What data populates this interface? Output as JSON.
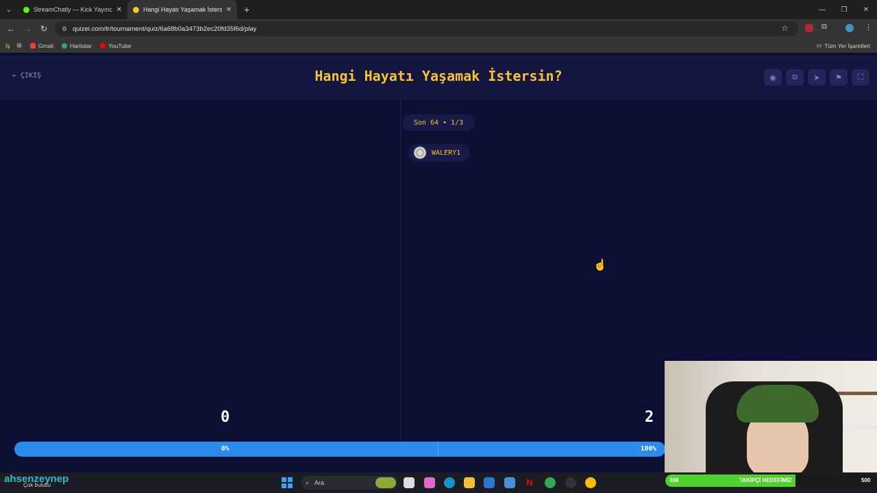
{
  "browser": {
    "tabs": [
      {
        "label": "StreamChatly — Kick Yayıncıları",
        "active": false,
        "fav_color": "#53fc18"
      },
      {
        "label": "Hangi Hayatı Yaşamak İstersin?",
        "active": true,
        "fav_color": "#f7c531"
      }
    ],
    "url": "quizei.com/tr/tournament/quiz/6a68b0a3473b2ec20fd35f6d/play",
    "bookmarks": [
      {
        "label": "Gmail",
        "color": "#ea4335"
      },
      {
        "label": "Haritalar",
        "color": "#34a853"
      },
      {
        "label": "YouTube",
        "color": "#ff0000"
      }
    ],
    "all_bookmarks": "Tüm Yer İşaretleri"
  },
  "page": {
    "exit_label": "ÇIKIŞ",
    "title": "Hangi Hayatı Yaşamak İstersin?",
    "round_label": "Son 64 • 1/3",
    "player_name": "WALERY1",
    "left_score": "0",
    "right_score": "2",
    "left_percent": "0%",
    "right_percent": "100%",
    "vote_share_right": 1.0
  },
  "overlay": {
    "streamer_name": "ahsenzeynep",
    "weather_text": "Çok bulutlu",
    "goal_current": "308",
    "goal_label": "TAKİPÇİ HEDEFİMİZ",
    "goal_target": "500",
    "goal_progress": 0.616
  },
  "taskbar": {
    "search_placeholder": "Ara"
  },
  "colors": {
    "accent": "#f7c531",
    "background": "#0e0f35",
    "bar": "#2d8bec"
  }
}
